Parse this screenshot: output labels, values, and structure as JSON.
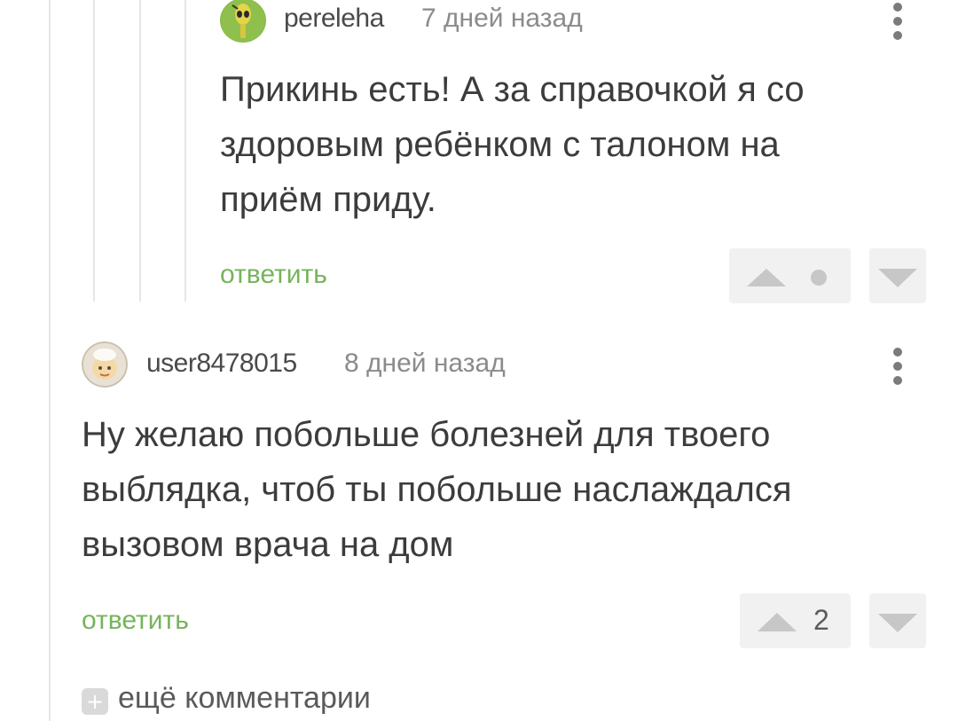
{
  "comments": [
    {
      "username": "pereleha",
      "time": "7 дней назад",
      "text_lines": [
        "Прикинь есть! А за справочкой я со",
        "здоровым ребёнком с талоном на",
        "приём приду."
      ],
      "reply_label": "ответить",
      "score": "",
      "avatar_icon": "alien-avatar-icon"
    },
    {
      "username": "user8478015",
      "time": "8 дней назад",
      "text_lines": [
        "Ну желаю побольше болезней для твоего",
        "выблядка, чтоб ты побольше наслаждался",
        "вызовом врача на дом"
      ],
      "reply_label": "ответить",
      "score": "2",
      "avatar_icon": "cartoon-face-avatar-icon"
    }
  ],
  "more_comments": {
    "label": "ещё комментарии",
    "icon": "+"
  },
  "colors": {
    "accent_green": "#76b45b",
    "vote_bg": "#f1f1f1",
    "arrow": "#c7c7c7"
  }
}
